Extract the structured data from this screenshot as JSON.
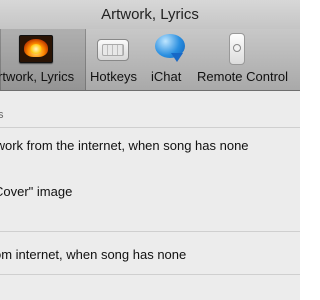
{
  "window": {
    "title": "Artwork, Lyrics"
  },
  "toolbar": {
    "items": [
      {
        "label": "rtwork, Lyrics",
        "icon": "artwork-icon",
        "selected": true
      },
      {
        "label": "Hotkeys",
        "icon": "keyboard-icon"
      },
      {
        "label": "iChat",
        "icon": "ichat-icon"
      },
      {
        "label": "Remote Control",
        "icon": "remote-icon"
      }
    ]
  },
  "content": {
    "section_label": "s",
    "rows": [
      "twork from the internet, when song has none",
      "Cover\" image",
      "om internet, when song has none"
    ]
  }
}
